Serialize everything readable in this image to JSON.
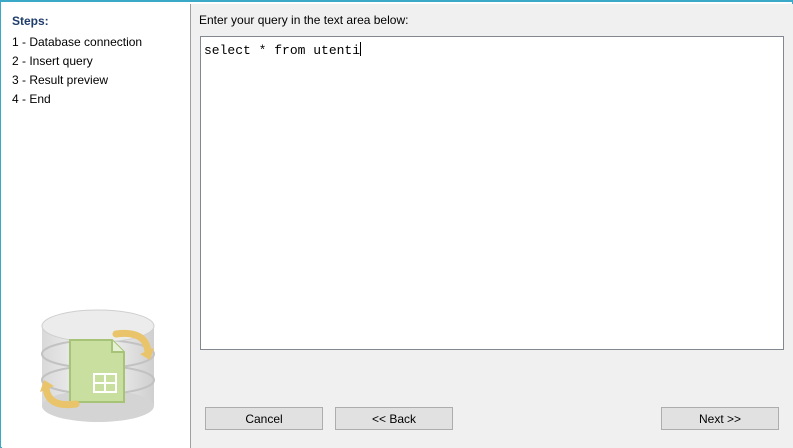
{
  "steps": {
    "title": "Steps:",
    "items": [
      {
        "label": "1 - Database connection"
      },
      {
        "label": "2 - Insert query"
      },
      {
        "label": "3 - Result preview"
      },
      {
        "label": "4 - End"
      }
    ],
    "logo_icon": "database-spreadsheet-sync-icon"
  },
  "main": {
    "prompt": "Enter your query in the text area below:",
    "query_text": "select * from utenti"
  },
  "buttons": {
    "cancel": "Cancel",
    "back": "<< Back",
    "next": "Next >>"
  },
  "colors": {
    "frame_accent": "#3aa9c7",
    "steps_title": "#1f3c6b",
    "panel_bg": "#f0f0f0"
  }
}
